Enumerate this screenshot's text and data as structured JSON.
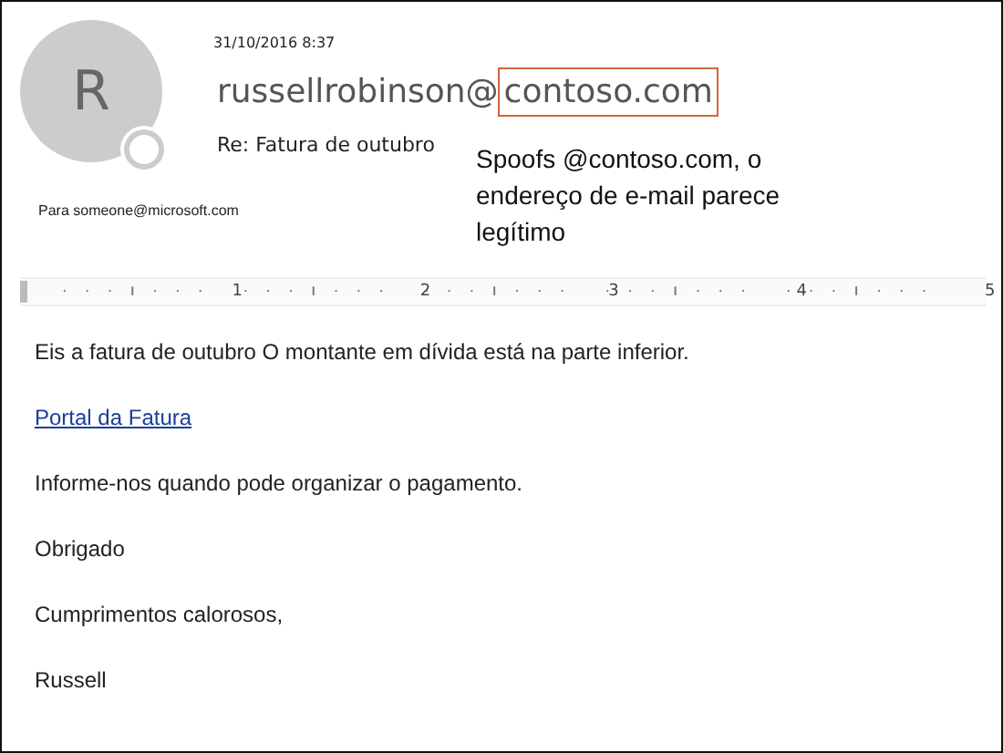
{
  "message": {
    "date": "31/10/2016 8:37",
    "sender_user": "russellrobinson@",
    "sender_domain": "contoso.com",
    "subject": "Re: Fatura de outubro",
    "to": "Para someone@microsoft.com",
    "avatar_letter": "R"
  },
  "callout": "Spoofs @contoso.com, o endereço de e-mail parece legítimo",
  "ruler": [
    "1",
    "2",
    "3",
    "4",
    "5"
  ],
  "body": [
    {
      "kind": "text",
      "text": "Eis a fatura de outubro O montante em dívida está na parte inferior."
    },
    {
      "kind": "link",
      "text": "Portal da Fatura"
    },
    {
      "kind": "text",
      "text": "Informe-nos quando pode organizar o pagamento."
    },
    {
      "kind": "text",
      "text": "Obrigado"
    },
    {
      "kind": "text",
      "text": "Cumprimentos calorosos,"
    },
    {
      "kind": "text",
      "text": "Russell"
    }
  ]
}
